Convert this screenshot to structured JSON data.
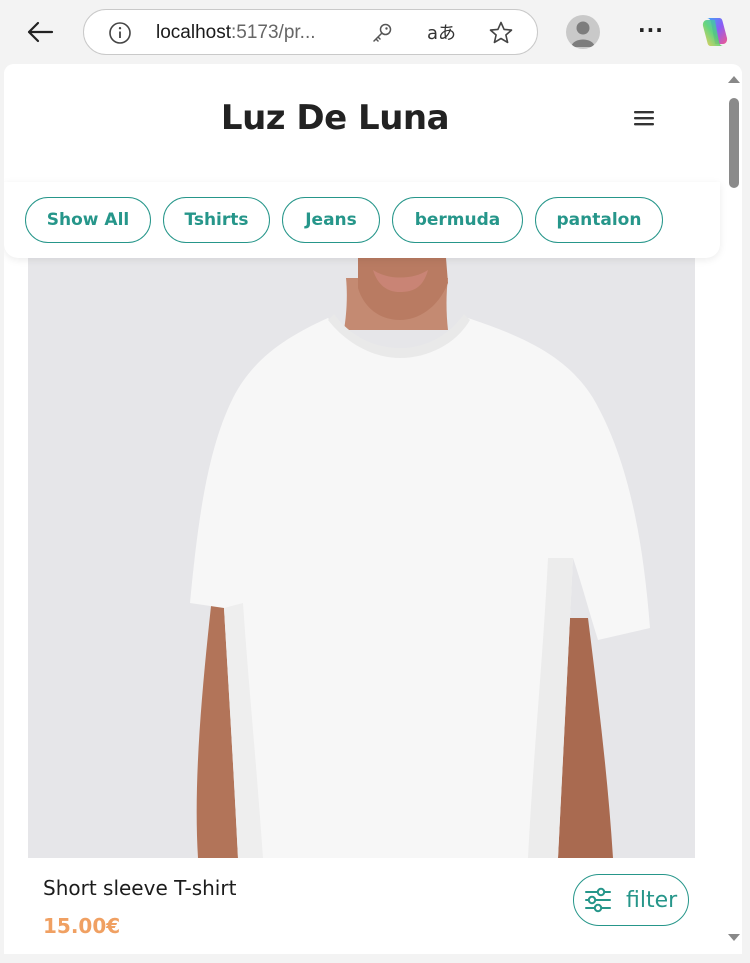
{
  "browser": {
    "url_host": "localhost",
    "url_rest": ":5173/pr...",
    "translate_glyph": "aあ",
    "more_glyph": "···"
  },
  "site": {
    "title": "Luz De Luna"
  },
  "categories": [
    {
      "label": "Show All"
    },
    {
      "label": "Tshirts"
    },
    {
      "label": "Jeans"
    },
    {
      "label": "bermuda"
    },
    {
      "label": "pantalon"
    }
  ],
  "product": {
    "name": "Short sleeve T-shirt",
    "price": "15.00€"
  },
  "filter_button": {
    "label": "filter"
  },
  "colors": {
    "accent": "#26968a",
    "price": "#f0a062"
  },
  "icons": {
    "back": "arrow-left-icon",
    "info": "info-icon",
    "key": "key-icon",
    "translate": "translate-icon",
    "favorite": "star-icon",
    "menu": "hamburger-menu-icon",
    "filter": "sliders-icon",
    "copilot": "copilot-icon"
  }
}
